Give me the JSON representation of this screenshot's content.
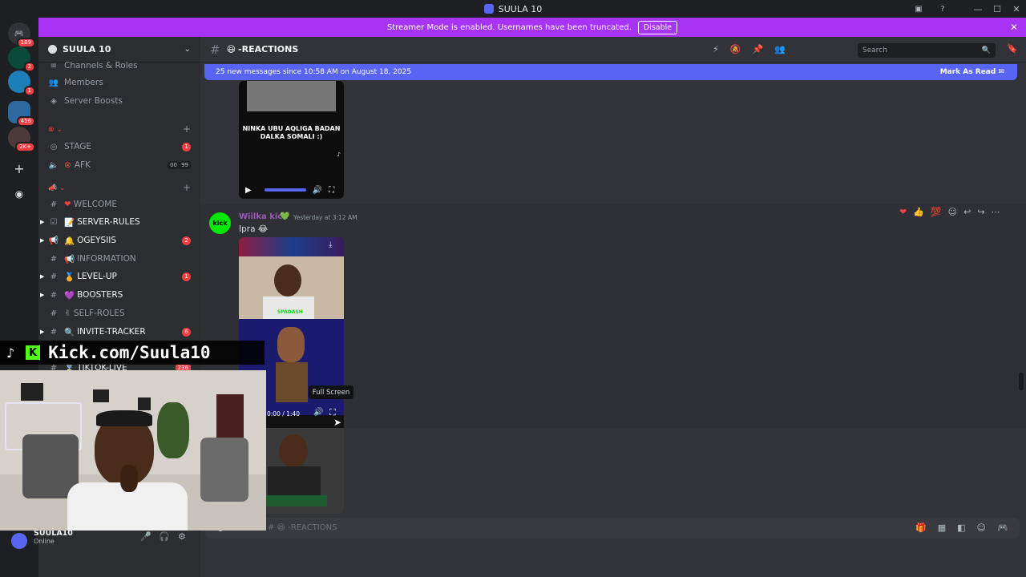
{
  "window": {
    "title": "SUULA 10"
  },
  "banner": {
    "text": "Streamer Mode is enabled. Usernames have been truncated.",
    "disable_label": "Disable"
  },
  "guilds": [
    {
      "name": "discord-home",
      "badge": "189"
    },
    {
      "name": "server-1",
      "badge": "2"
    },
    {
      "name": "server-2",
      "badge": "1"
    },
    {
      "name": "server-3",
      "badge": "456"
    },
    {
      "name": "server-4",
      "badge": "2K+"
    }
  ],
  "server": {
    "name": "SUULA 10"
  },
  "sidebar": {
    "top_items": [
      {
        "label": "Channels & Roles"
      },
      {
        "label": "Members"
      },
      {
        "label": "Server Boosts"
      }
    ],
    "voice_channels": [
      {
        "label": "STAGE",
        "badge": "1"
      },
      {
        "label": "AFK",
        "pill1": "00",
        "pill2": "99"
      }
    ],
    "text_channels": [
      {
        "label": "WELCOME",
        "emoji": "❤"
      },
      {
        "label": "SERVER-RULES",
        "emoji": "📝"
      },
      {
        "label": "OGEYSIIS",
        "emoji": "🔔",
        "badge": "2"
      },
      {
        "label": "INFORMATION",
        "emoji": "📢"
      },
      {
        "label": "LEVEL-UP",
        "emoji": "🏅",
        "badge": "1"
      },
      {
        "label": "BOOSTERS",
        "emoji": "💜"
      },
      {
        "label": "SELF-ROLES",
        "emoji": "✌"
      },
      {
        "label": "INVITE-TRACKER",
        "emoji": "🔍",
        "badge": "6"
      },
      {
        "label": "TIKTOK-LIVE",
        "emoji": "⌛",
        "badge": "236"
      }
    ]
  },
  "user": {
    "name": "SUULA10",
    "status": "Online"
  },
  "channel": {
    "name": "-REACTIONS",
    "emoji": "😆"
  },
  "search": {
    "placeholder": "Search"
  },
  "new_messages": {
    "text": "25 new messages since 10:58 AM on August 18, 2025",
    "mark_label": "Mark As Read"
  },
  "media1": {
    "caption": "NINKA UBU AQLIGA BADAN DALKA SOMALI :)"
  },
  "message": {
    "author": "Wiilka kick",
    "time": "Yesterday at 3:12 AM",
    "text": "Ipra 😂",
    "video_time": "0:00 / 1:40",
    "tooltip": "Full Screen",
    "media_label": "SPADASH"
  },
  "composer": {
    "placeholder": "# 😆 -REACTIONS"
  },
  "overlay": {
    "kick_text": "Kick.com/Suula10"
  }
}
